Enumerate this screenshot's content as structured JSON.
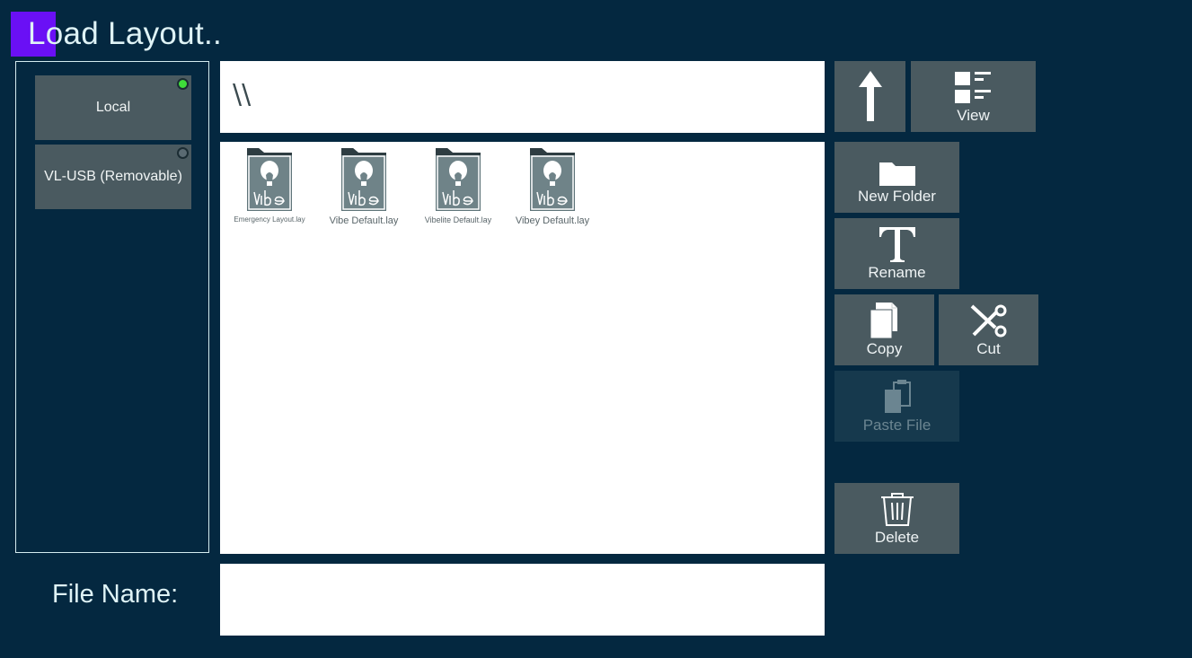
{
  "dialog": {
    "title": "Load Layout.."
  },
  "drives": [
    {
      "label": "Local",
      "status": "connected",
      "status_color": "#3fdc3a"
    },
    {
      "label": "VL-USB (Removable)",
      "status": "disconnected",
      "status_color": "#5a6a72"
    }
  ],
  "path": {
    "current": "\\\\"
  },
  "files": [
    {
      "name": "Emergency Layout.lay",
      "icon": "vibe-layout-file-icon"
    },
    {
      "name": "Vibe Default.lay",
      "icon": "vibe-layout-file-icon"
    },
    {
      "name": "Vibelite Default.lay",
      "icon": "vibe-layout-file-icon"
    },
    {
      "name": "Vibey Default.lay",
      "icon": "vibe-layout-file-icon"
    }
  ],
  "file_name": {
    "label": "File Name:",
    "value": ""
  },
  "toolbar": {
    "up": {
      "label": "",
      "icon": "arrow-up-icon"
    },
    "view": {
      "label": "View",
      "icon": "view-list-icon"
    },
    "new_folder": {
      "label": "New Folder",
      "icon": "folder-icon"
    },
    "rename": {
      "label": "Rename",
      "icon": "text-t-icon"
    },
    "copy": {
      "label": "Copy",
      "icon": "copy-icon"
    },
    "cut": {
      "label": "Cut",
      "icon": "scissors-icon"
    },
    "paste": {
      "label": "Paste File",
      "icon": "paste-icon",
      "enabled": false
    },
    "delete": {
      "label": "Delete",
      "icon": "trash-icon"
    }
  }
}
